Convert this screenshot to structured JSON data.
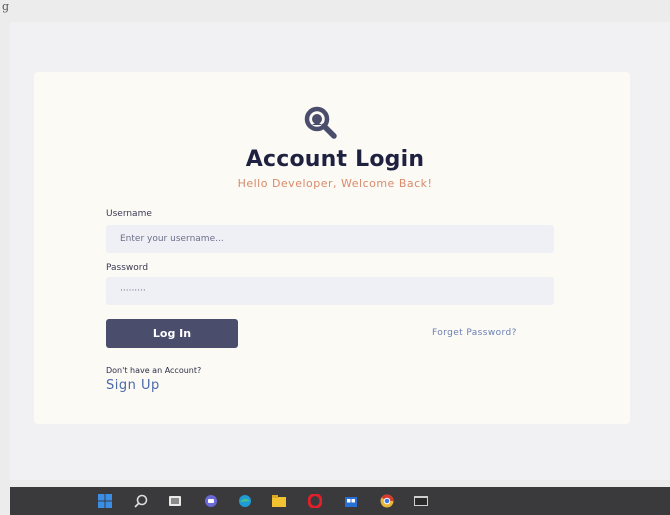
{
  "top_label": "g",
  "login": {
    "title": "Account Login",
    "subtitle": "Hello Developer, Welcome Back!",
    "username_label": "Username",
    "username_placeholder": "Enter your username...",
    "password_label": "Password",
    "password_value": "·········",
    "login_button": "Log In",
    "forgot_link": "Forget Password?",
    "no_account_text": "Don't have an Account?",
    "signup_link": "Sign Up"
  },
  "taskbar": {
    "icons": [
      "windows-start-icon",
      "search-icon",
      "task-view-icon",
      "chat-icon",
      "edge-icon",
      "file-explorer-icon",
      "opera-icon",
      "store-icon",
      "chrome-icon",
      "terminal-icon"
    ]
  },
  "colors": {
    "title": "#1f2140",
    "subtitle": "#d98a6a",
    "button_bg": "#4a4d6b",
    "link": "#4c6aa8",
    "card_bg": "#fbfaf5",
    "taskbar_bg": "#3a3a3d"
  }
}
